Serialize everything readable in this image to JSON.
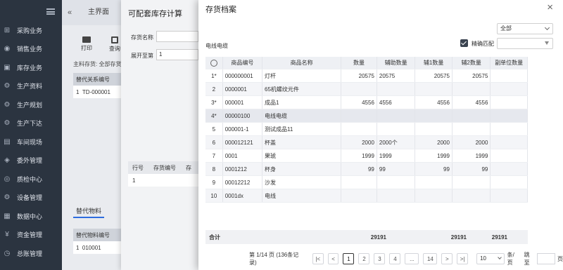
{
  "sidebar": {
    "items": [
      {
        "label": "采购业务",
        "icon": "cart-icon"
      },
      {
        "label": "销售业务",
        "icon": "sales-icon"
      },
      {
        "label": "库存业务",
        "icon": "warehouse-icon"
      },
      {
        "label": "生产资料",
        "icon": "factory-icon"
      },
      {
        "label": "生产规划",
        "icon": "plan-icon"
      },
      {
        "label": "生产下达",
        "icon": "dispatch-icon"
      },
      {
        "label": "车间现场",
        "icon": "workshop-icon"
      },
      {
        "label": "委外管理",
        "icon": "outsource-icon"
      },
      {
        "label": "质检中心",
        "icon": "inspect-icon"
      },
      {
        "label": "设备管理",
        "icon": "equipment-icon"
      },
      {
        "label": "数据中心",
        "icon": "data-icon"
      },
      {
        "label": "资金管理",
        "icon": "fund-icon"
      },
      {
        "label": "总账管理",
        "icon": "ledger-icon"
      }
    ]
  },
  "main": {
    "tab_home": "主界面",
    "print_label": "打印",
    "query_label": "查询",
    "main_label": "主料存货: 全部存货",
    "sub_header": "替代关系编号",
    "sub_row": "TD-000001",
    "sub_row_index": "1",
    "replace_tab": "替代物料",
    "sub2_header": "替代物料编号",
    "sub2_row": "010001",
    "sub2_row_index": "1"
  },
  "mid_dialog": {
    "title": "可配套库存计算",
    "field1_label": "存货名称",
    "field2_label": "展开至第",
    "field2_value": "1",
    "col_row": "行号",
    "col_code": "存货编号",
    "col_extra": "存",
    "row_index": "1"
  },
  "dialog": {
    "title": "存货档案",
    "close": "×",
    "select_value": "全部",
    "search_text": "电线电缆",
    "exact_match": "精确匹配",
    "columns": [
      "商品编号",
      "商品名称",
      "数量",
      "辅助数量",
      "辅1数量",
      "辅2数量",
      "副单位数量"
    ],
    "rows": [
      {
        "idx": "1*",
        "code": "000000001",
        "name": "灯杆",
        "qty": "20575",
        "aux": "20575",
        "a1": "20575",
        "a2": "20575",
        "sub": ""
      },
      {
        "idx": "2",
        "code": "0000001",
        "name": "65机螺纹元件",
        "qty": "",
        "aux": "",
        "a1": "",
        "a2": "",
        "sub": ""
      },
      {
        "idx": "3*",
        "code": "000001",
        "name": "成品1",
        "qty": "4556",
        "aux": "4556",
        "a1": "4556",
        "a2": "4556",
        "sub": ""
      },
      {
        "idx": "4*",
        "code": "00000100",
        "name": "电线电缆",
        "qty": "",
        "aux": "",
        "a1": "",
        "a2": "",
        "sub": ""
      },
      {
        "idx": "5",
        "code": "000001-1",
        "name": "测试成品11",
        "qty": "",
        "aux": "",
        "a1": "",
        "a2": "",
        "sub": ""
      },
      {
        "idx": "6",
        "code": "000012121",
        "name": "杯盖",
        "qty": "2000",
        "aux": "2000个",
        "a1": "2000",
        "a2": "2000",
        "sub": ""
      },
      {
        "idx": "7",
        "code": "0001",
        "name": "果琥",
        "qty": "1999",
        "aux": "1999",
        "a1": "1999",
        "a2": "1999",
        "sub": ""
      },
      {
        "idx": "8",
        "code": "0001212",
        "name": "杯身",
        "qty": "99",
        "aux": "99",
        "a1": "99",
        "a2": "99",
        "sub": ""
      },
      {
        "idx": "9",
        "code": "00012212",
        "name": "沙发",
        "qty": "",
        "aux": "",
        "a1": "",
        "a2": "",
        "sub": ""
      },
      {
        "idx": "10",
        "code": "0001dx",
        "name": "电线",
        "qty": "",
        "aux": "",
        "a1": "",
        "a2": "",
        "sub": ""
      }
    ],
    "total_label": "合计",
    "total_qty": "29191",
    "total_a1": "29191",
    "total_a2": "29191",
    "pager": {
      "info": "第 1/14 页 (136条记录)",
      "pages": [
        "1",
        "2",
        "3",
        "4",
        "...",
        "14"
      ],
      "size": "10",
      "size_unit": "条/页",
      "jump_label": "跳至",
      "page_unit": "页"
    }
  }
}
